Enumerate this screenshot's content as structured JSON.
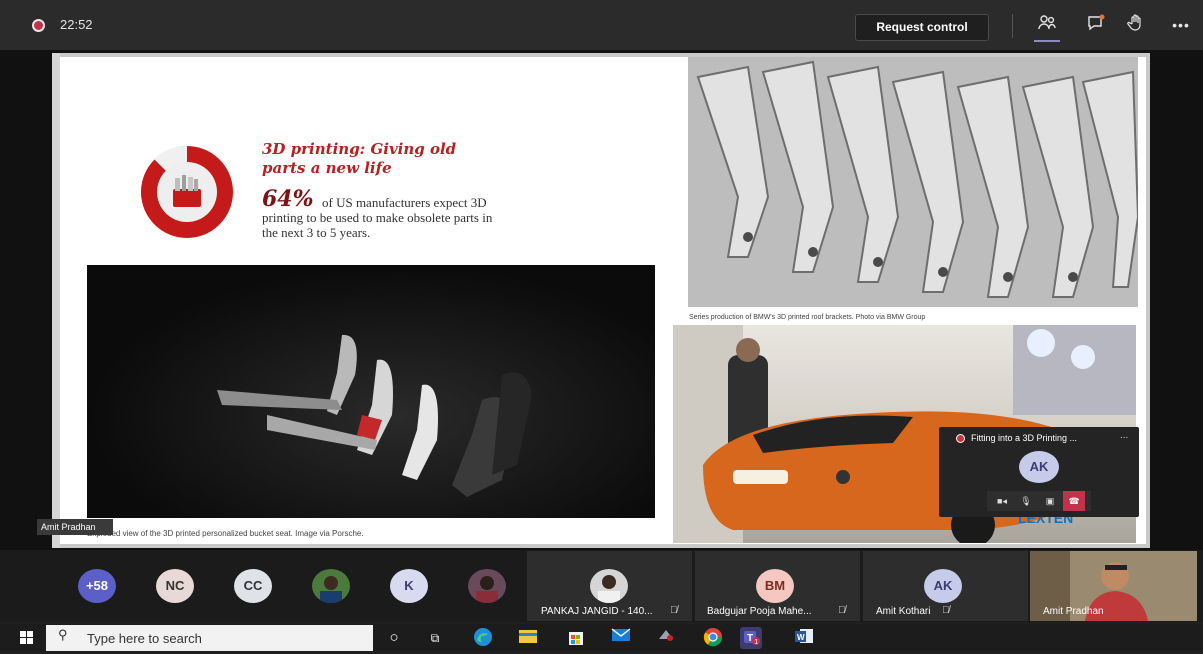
{
  "meeting": {
    "timer": "22:52",
    "request_control_label": "Request control"
  },
  "slide": {
    "headline": "3D printing: Giving old parts a new life",
    "stat_value": "64%",
    "stat_text": "of US manufacturers expect 3D printing to be used to make obsolete parts in the next 3 to 5 years.",
    "caption_brackets": "Series production of BMW's 3D printed roof brackets. Photo via BMW Group",
    "caption_seat": "Exploded view of the 3D printed personalized bucket seat. Image via Porsche.",
    "car_logo_text": "LEXTEN"
  },
  "mini_window": {
    "title": "Fitting into a 3D Printing ...",
    "more": "...",
    "avatar_initials": "AK"
  },
  "presenter_label": "Amit Pradhan",
  "participants": {
    "overflow_count": "+58",
    "avatars": [
      {
        "initials": "NC"
      },
      {
        "initials": "CC"
      },
      {
        "initials": "K"
      }
    ],
    "tiles": [
      {
        "name": "PANKAJ JANGID - 140..."
      },
      {
        "name": "Badgujar Pooja Mahe...",
        "initials": "BM"
      },
      {
        "name": "Amit Kothari",
        "initials": "AK"
      }
    ],
    "camera_name": "Amit Pradhan"
  },
  "taskbar": {
    "search_placeholder": "Type here to search",
    "teams_badge": "1"
  },
  "colors": {
    "accent_red": "#b52020",
    "teams_purple": "#6264a7",
    "hangup_red": "#c4314b"
  }
}
